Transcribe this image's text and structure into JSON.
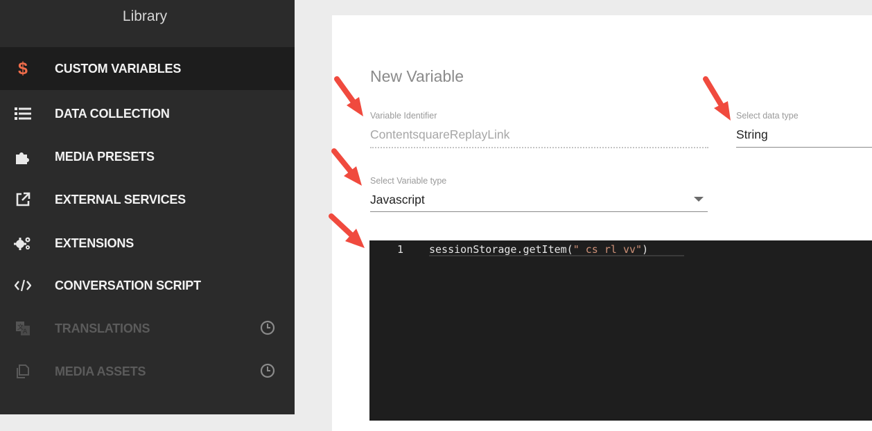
{
  "sidebar": {
    "title": "Library",
    "items": [
      {
        "label": "CUSTOM VARIABLES",
        "icon": "dollar-icon",
        "active": true,
        "disabled": false
      },
      {
        "label": "DATA COLLECTION",
        "icon": "list-icon",
        "active": false,
        "disabled": false
      },
      {
        "label": "MEDIA PRESETS",
        "icon": "puzzle-icon",
        "active": false,
        "disabled": false
      },
      {
        "label": "EXTERNAL SERVICES",
        "icon": "external-link-icon",
        "active": false,
        "disabled": false
      },
      {
        "label": "EXTENSIONS",
        "icon": "gears-icon",
        "active": false,
        "disabled": false
      },
      {
        "label": "CONVERSATION SCRIPT",
        "icon": "code-icon",
        "active": false,
        "disabled": false
      },
      {
        "label": "TRANSLATIONS",
        "icon": "translate-icon",
        "active": false,
        "disabled": true
      },
      {
        "label": "MEDIA ASSETS",
        "icon": "copy-icon",
        "active": false,
        "disabled": true
      }
    ]
  },
  "form": {
    "title": "New Variable",
    "identifier": {
      "label": "Variable Identifier",
      "value": "ContentsquareReplayLink"
    },
    "data_type": {
      "label": "Select data type",
      "value": "String"
    },
    "variable_type": {
      "label": "Select Variable type",
      "value": "Javascript"
    }
  },
  "editor": {
    "line_number": "1",
    "code_prefix": "sessionStorage.getItem(",
    "code_string": "\"_cs_rl_vv\"",
    "code_suffix": ")"
  },
  "colors": {
    "accent": "#ef6c4a",
    "arrow": "#f04a3e",
    "sidebar_bg": "#2b2b2b",
    "editor_bg": "#1e1e1e",
    "string_token": "#ce9178"
  }
}
